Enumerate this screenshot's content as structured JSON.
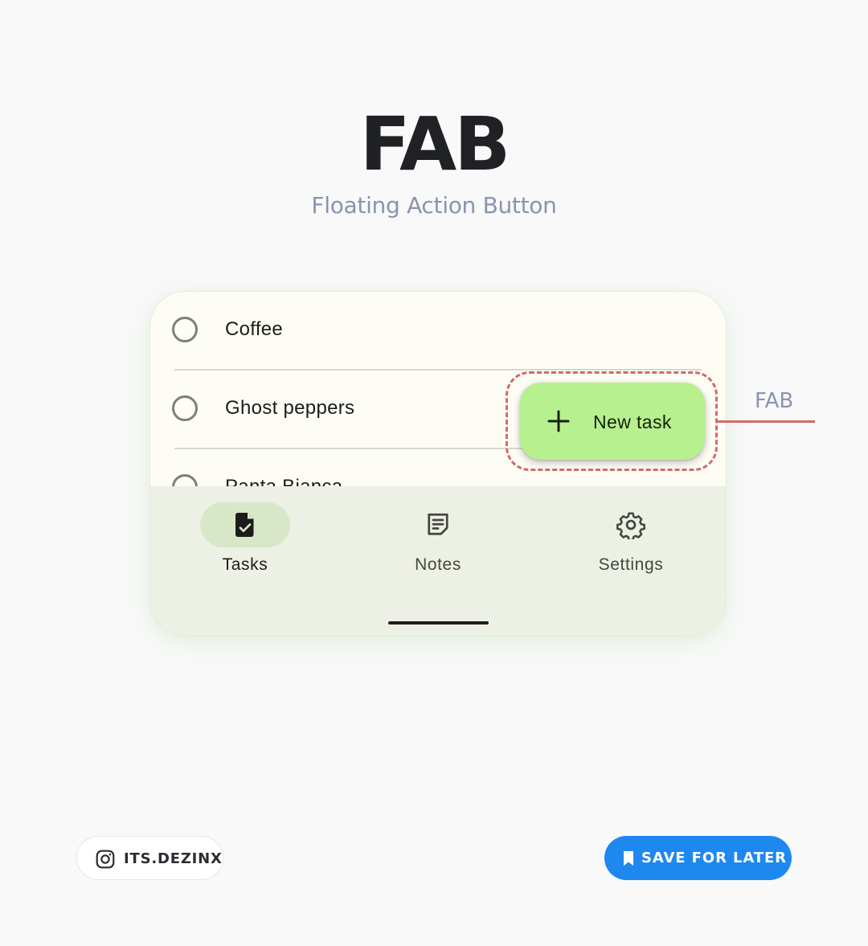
{
  "header": {
    "title": "FAB",
    "subtitle": "Floating Action Button"
  },
  "tasks": [
    {
      "label": "Coffee",
      "checked": false
    },
    {
      "label": "Ghost peppers",
      "checked": false
    },
    {
      "label": "Panta Bianca",
      "checked": false
    }
  ],
  "fab": {
    "icon": "plus-icon",
    "label": "New task",
    "color": "#b7f08f"
  },
  "callout": {
    "label": "FAB",
    "color": "#d36a6a"
  },
  "bottom_nav": {
    "items": [
      {
        "label": "Tasks",
        "icon": "task-document-check-icon",
        "active": true
      },
      {
        "label": "Notes",
        "icon": "notes-icon",
        "active": false
      },
      {
        "label": "Settings",
        "icon": "gear-icon",
        "active": false
      }
    ]
  },
  "footer": {
    "handle": "ITS.DEZINX",
    "handle_icon": "instagram-icon",
    "save_label": "SAVE FOR LATER",
    "save_icon": "bookmark-icon",
    "save_color": "#1e88f0"
  }
}
